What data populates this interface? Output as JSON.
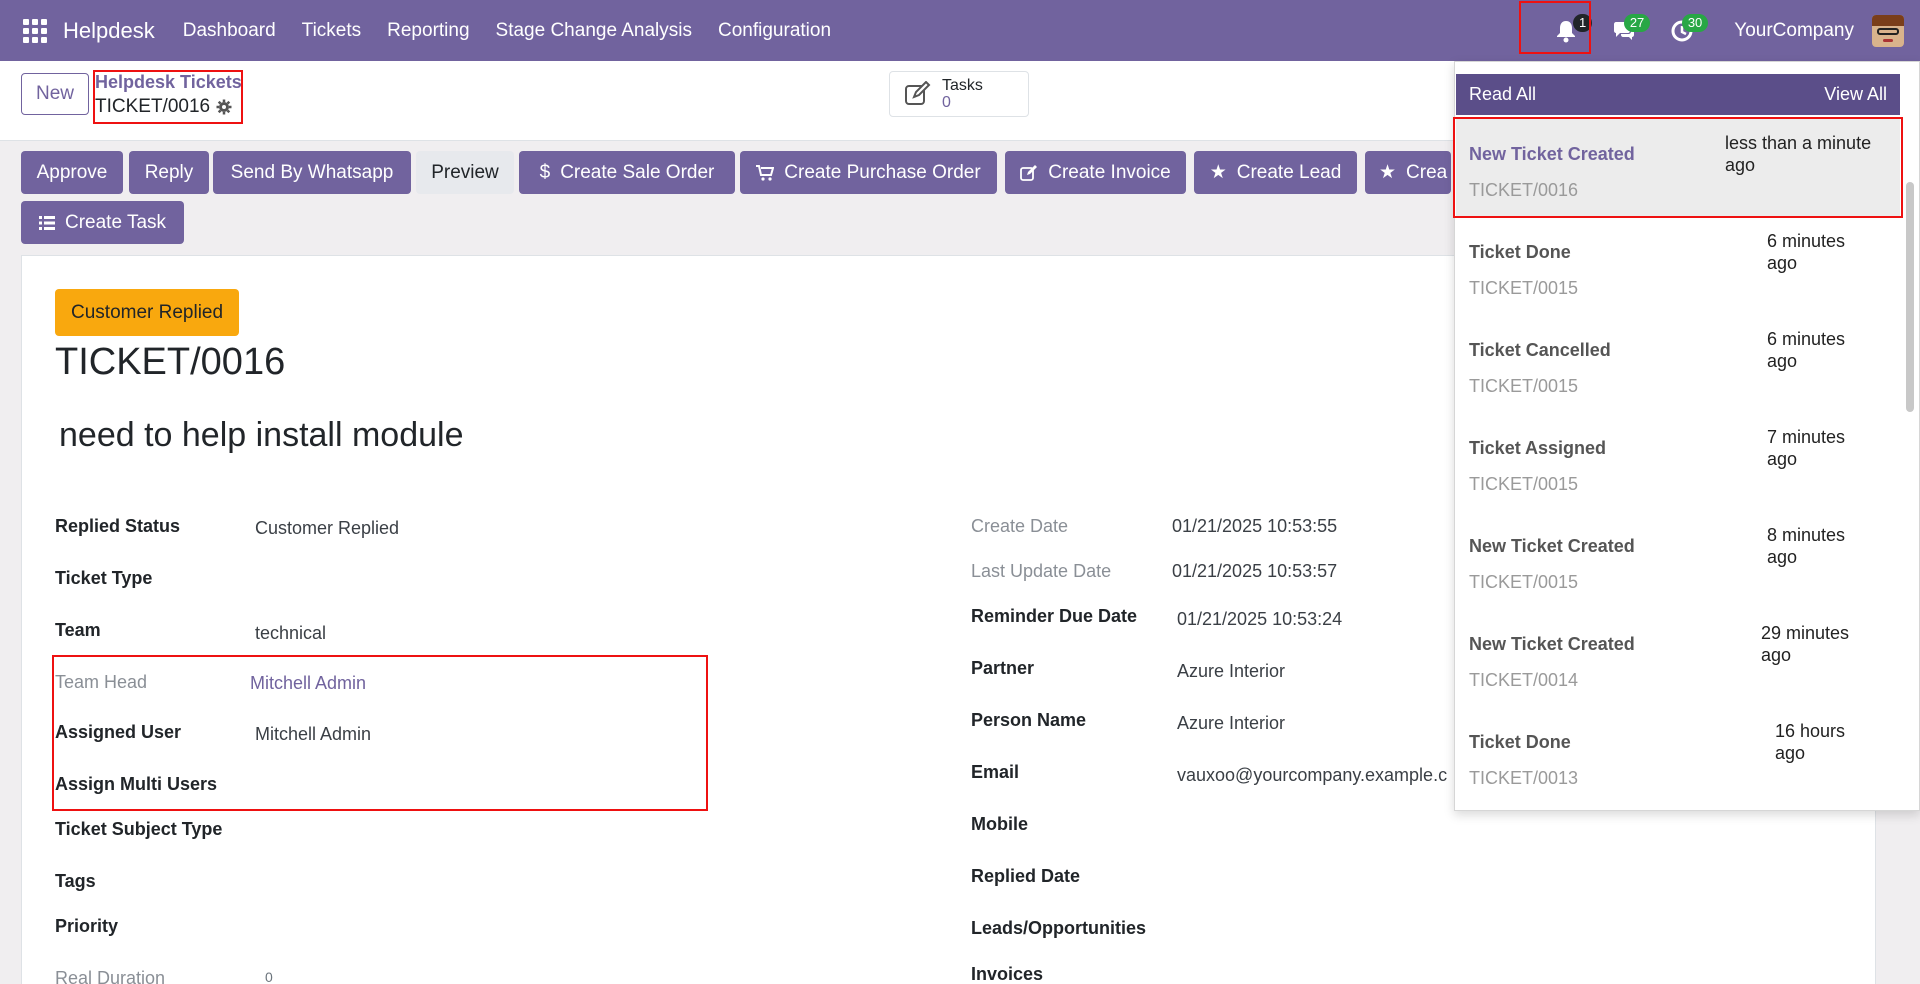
{
  "app": {
    "name": "Helpdesk",
    "menu": [
      "Dashboard",
      "Tickets",
      "Reporting",
      "Stage Change Analysis",
      "Configuration"
    ],
    "company": "YourCompany",
    "badges": {
      "notifications": "1",
      "messages": "27",
      "activities": "30"
    }
  },
  "control_panel": {
    "new_label": "New",
    "breadcrumb_parent": "Helpdesk Tickets",
    "breadcrumb_current": "TICKET/0016",
    "tasks_label": "Tasks",
    "tasks_count": "0"
  },
  "actions": {
    "approve": "Approve",
    "reply": "Reply",
    "send_whatsapp": "Send By Whatsapp",
    "preview": "Preview",
    "create_sale_order": "Create Sale Order",
    "create_purchase_order": "Create Purchase Order",
    "create_invoice": "Create Invoice",
    "create_lead": "Create Lead",
    "create_truncated": "Crea",
    "create_task": "Create Task"
  },
  "ticket": {
    "status": "Customer Replied",
    "number": "TICKET/0016",
    "name": "need to help install module",
    "left_fields": [
      {
        "label": "Replied Status",
        "value": "Customer Replied"
      },
      {
        "label": "Ticket Type",
        "value": ""
      },
      {
        "label": "Team",
        "value": "technical"
      },
      {
        "label": "Team Head",
        "value": "Mitchell Admin"
      },
      {
        "label": "Assigned User",
        "value": "Mitchell Admin"
      },
      {
        "label": "Assign Multi Users",
        "value": ""
      },
      {
        "label": "Ticket Subject Type",
        "value": ""
      },
      {
        "label": "Tags",
        "value": ""
      },
      {
        "label": "Priority",
        "value": ""
      },
      {
        "label": "Real Duration",
        "value": "0"
      }
    ],
    "right_fields": [
      {
        "label": "Create Date",
        "value": "01/21/2025 10:53:55"
      },
      {
        "label": "Last Update Date",
        "value": "01/21/2025 10:53:57"
      },
      {
        "label": "Reminder Due Date",
        "value": "01/21/2025 10:53:24"
      },
      {
        "label": "Partner",
        "value": "Azure Interior"
      },
      {
        "label": "Person Name",
        "value": "Azure Interior"
      },
      {
        "label": "Email",
        "value": "vauxoo@yourcompany.example.c"
      },
      {
        "label": "Mobile",
        "value": ""
      },
      {
        "label": "Replied Date",
        "value": ""
      },
      {
        "label": "Leads/Opportunities",
        "value": ""
      },
      {
        "label": "Invoices",
        "value": ""
      }
    ]
  },
  "notifications": {
    "read_all": "Read All",
    "view_all": "View All",
    "items": [
      {
        "title": "New Ticket Created",
        "ticket": "TICKET/0016",
        "time": "less than a minute ago"
      },
      {
        "title": "Ticket Done",
        "ticket": "TICKET/0015",
        "time": "6 minutes ago"
      },
      {
        "title": "Ticket Cancelled",
        "ticket": "TICKET/0015",
        "time": "6 minutes ago"
      },
      {
        "title": "Ticket Assigned",
        "ticket": "TICKET/0015",
        "time": "7 minutes ago"
      },
      {
        "title": "New Ticket Created",
        "ticket": "TICKET/0015",
        "time": "8 minutes ago"
      },
      {
        "title": "New Ticket Created",
        "ticket": "TICKET/0014",
        "time": "29 minutes ago"
      },
      {
        "title": "Ticket Done",
        "ticket": "TICKET/0013",
        "time": "16 hours ago"
      }
    ]
  },
  "colors": {
    "brand": "#71639e",
    "status_badge": "#f9a80e",
    "highlight": "#e11111"
  }
}
